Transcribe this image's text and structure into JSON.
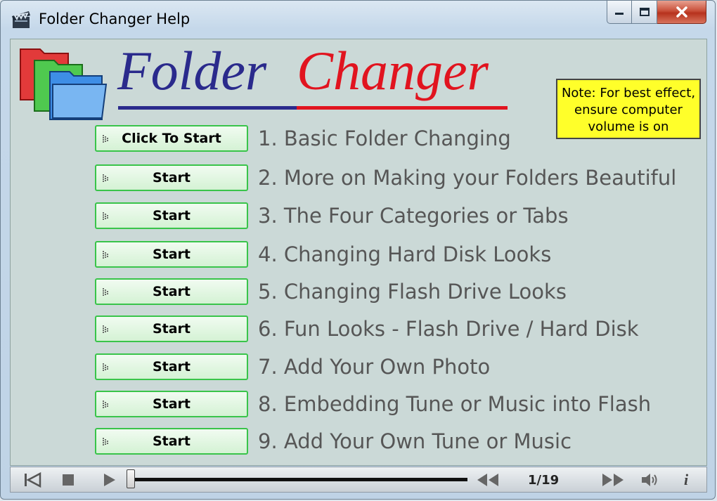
{
  "window": {
    "title": "Folder Changer Help",
    "icons": {
      "app": "clapperboard-icon",
      "minimize": "minimize-icon",
      "maximize": "maximize-icon",
      "close": "close-icon"
    }
  },
  "logo": {
    "word1": "Folder",
    "word2": "Changer",
    "icon": "folders-icon",
    "colors": {
      "word1": "#2a2a8c",
      "word2": "#e1141f"
    }
  },
  "note": {
    "lines": [
      "Note: For best effect,",
      "ensure computer",
      "volume is on"
    ],
    "color": "#ffff2a"
  },
  "lessons": [
    {
      "button": "Click To Start",
      "label": "1. Basic Folder Changing"
    },
    {
      "button": "Start",
      "label": "2. More on Making your Folders Beautiful"
    },
    {
      "button": "Start",
      "label": "3. The Four Categories or Tabs"
    },
    {
      "button": "Start",
      "label": "4. Changing Hard Disk Looks"
    },
    {
      "button": "Start",
      "label": "5. Changing Flash Drive Looks"
    },
    {
      "button": "Start",
      "label": "6. Fun Looks - Flash Drive / Hard Disk"
    },
    {
      "button": "Start",
      "label": "7. Add Your Own Photo"
    },
    {
      "button": "Start",
      "label": "8. Embedding Tune or Music into Flash"
    },
    {
      "button": "Start",
      "label": "9. Add Your Own Tune or Music"
    }
  ],
  "playbar": {
    "page": "1/19",
    "info": "i",
    "progress": 0,
    "icons": [
      "skip-start-icon",
      "stop-icon",
      "play-icon",
      "rewind-icon",
      "fast-forward-icon",
      "speaker-icon",
      "info-icon"
    ]
  }
}
